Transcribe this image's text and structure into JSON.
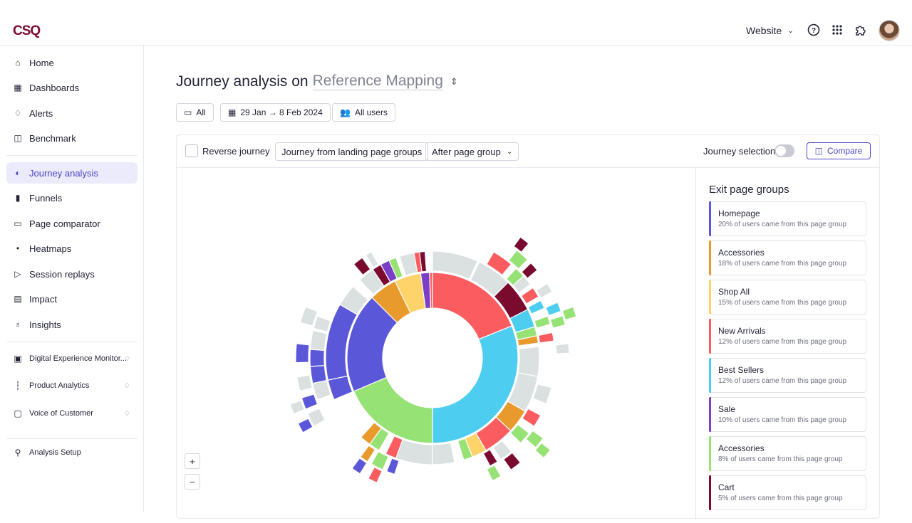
{
  "header": {
    "logo": "CSQ",
    "site_selector": "Website"
  },
  "sidebar": {
    "items": [
      {
        "label": "Home",
        "icon": "home-icon"
      },
      {
        "label": "Dashboards",
        "icon": "dashboards-icon"
      },
      {
        "label": "Alerts",
        "icon": "bell-icon"
      },
      {
        "label": "Benchmark",
        "icon": "benchmark-icon"
      },
      {
        "label": "Journey analysis",
        "icon": "journey-icon",
        "active": true
      },
      {
        "label": "Funnels",
        "icon": "funnel-icon"
      },
      {
        "label": "Page comparator",
        "icon": "page-comparator-icon"
      },
      {
        "label": "Heatmaps",
        "icon": "heatmap-icon"
      },
      {
        "label": "Session replays",
        "icon": "play-icon"
      },
      {
        "label": "Impact",
        "icon": "impact-icon"
      },
      {
        "label": "Insights",
        "icon": "lightbulb-icon"
      }
    ],
    "modules": [
      {
        "label": "Digital Experience Monitor...",
        "icon": "dem-icon"
      },
      {
        "label": "Product Analytics",
        "icon": "product-analytics-icon"
      },
      {
        "label": "Voice of Customer",
        "icon": "voc-icon"
      }
    ],
    "setup": {
      "label": "Analysis Setup",
      "icon": "setup-icon"
    }
  },
  "main": {
    "title_prefix": "Journey analysis on",
    "title_mapping": "Reference Mapping",
    "filters": {
      "devices": "All",
      "date_range": "29 Jan → 8 Feb 2024",
      "segment": "All users"
    },
    "toolbar": {
      "reverse_journey": "Reverse journey",
      "journey_from": "Journey from landing page groups",
      "after": "After page group",
      "journey_selection": "Journey selection",
      "compare": "Compare"
    },
    "zoom": {
      "in": "+",
      "out": "−"
    },
    "exit_panel": {
      "title": "Exit page groups",
      "items": [
        {
          "name": "Homepage",
          "desc": "20% of users came from this page group",
          "color": "#5b57d9"
        },
        {
          "name": "Accessories",
          "desc": "18% of users came from this page group",
          "color": "#e89a2c"
        },
        {
          "name": "Shop All",
          "desc": "15% of users came from this page group",
          "color": "#fdd36a"
        },
        {
          "name": "New Arrivals",
          "desc": "12% of users came from this page group",
          "color": "#fb5c5f"
        },
        {
          "name": "Best Sellers",
          "desc": "12% of users came from this page group",
          "color": "#4dcdf0"
        },
        {
          "name": "Sale",
          "desc": "10% of users came from this page group",
          "color": "#7b3fc6"
        },
        {
          "name": "Accessories",
          "desc": "8% of users came from this page group",
          "color": "#96e275"
        },
        {
          "name": "Cart",
          "desc": "5% of users came from this page group",
          "color": "#7a0a2e"
        }
      ]
    }
  }
}
